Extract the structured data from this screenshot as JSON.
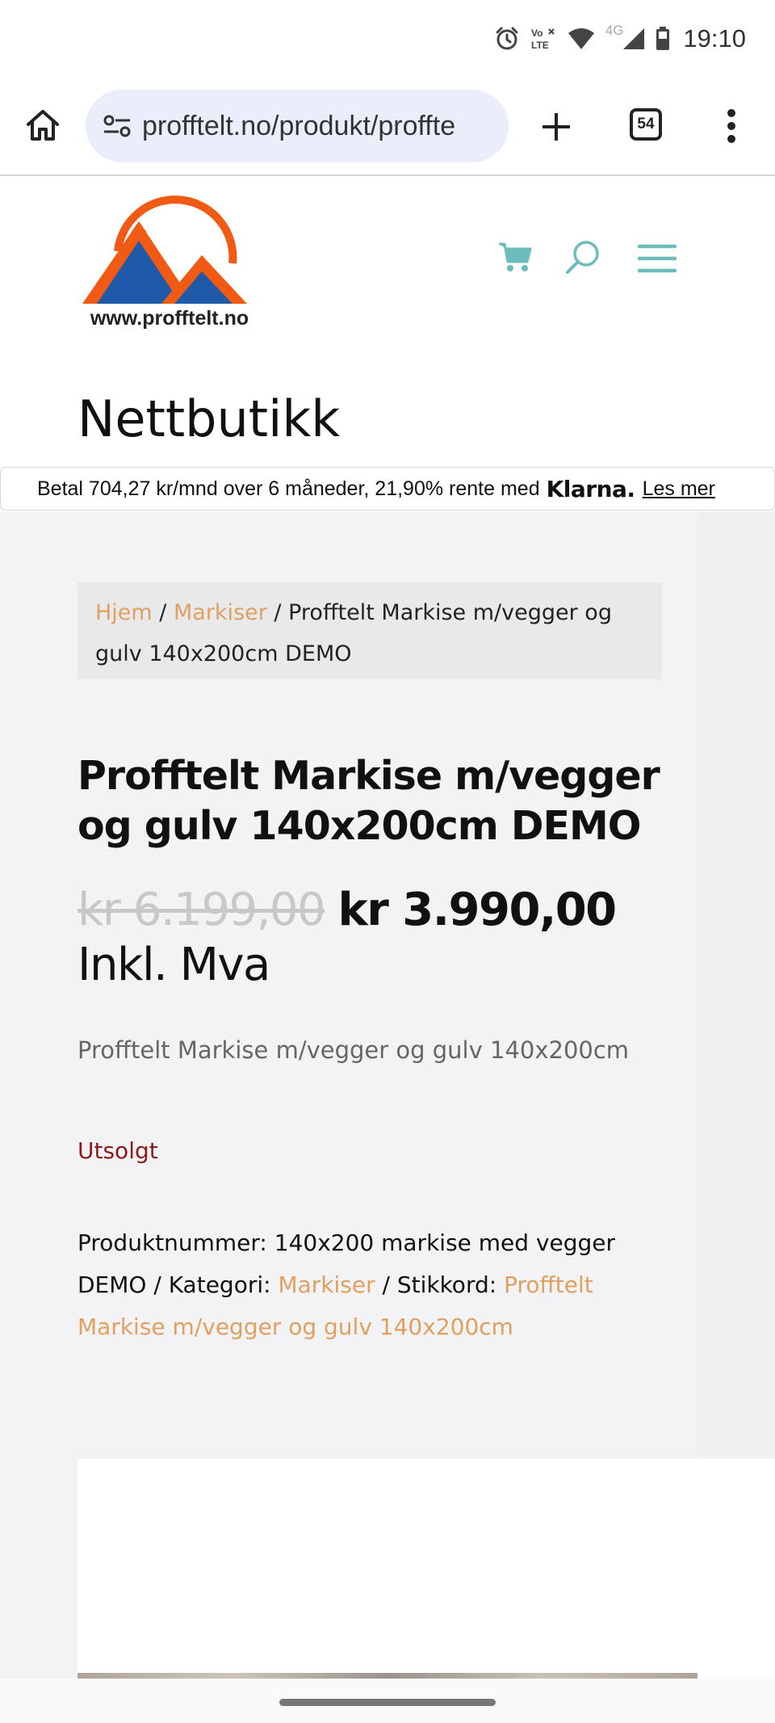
{
  "status_bar": {
    "time": "19:10",
    "network": "4G",
    "volte": "Vo LTE",
    "icons": [
      "alarm-icon",
      "volte-icon",
      "wifi-icon",
      "signal-icon",
      "battery-icon"
    ]
  },
  "browser": {
    "url": "profftelt.no/produkt/proffte",
    "tab_count": "54",
    "icons": [
      "home-icon",
      "site-settings-icon",
      "plus-icon",
      "tabs-icon",
      "more-vert-icon"
    ]
  },
  "header": {
    "logo_text": "www.profftelt.no",
    "icons": [
      "cart-icon",
      "search-icon",
      "menu-icon"
    ],
    "accent_color": "#6cbcbc"
  },
  "page": {
    "heading": "Nettbutikk"
  },
  "klarna": {
    "text": "Betal 704,27 kr/mnd over 6 måneder, 21,90% rente med",
    "logo": "Klarna.",
    "link": "Les mer"
  },
  "breadcrumb": {
    "home": "Hjem",
    "sep1": " / ",
    "category": "Markiser",
    "sep2": " / ",
    "current": "Profftelt Markise m/vegger og gulv 140x200cm DEMO"
  },
  "product": {
    "title": "Profftelt Markise m/vegger og gulv 140x200cm DEMO",
    "price_old": "kr 6.199,00",
    "price_new": "kr 3.990,00",
    "price_suffix": "Inkl. Mva",
    "short_description": "Profftelt Markise m/vegger og gulv 140x200cm",
    "stock_status": "Utsolgt",
    "meta": {
      "sku_label": "Produktnummer: ",
      "sku": "140x200 markise med vegger DEMO",
      "category_label": " / Kategori: ",
      "category": "Markiser",
      "tags_label": " / Stikkord: ",
      "tag": "Profftelt Markise m/vegger og gulv 140x200cm"
    }
  },
  "colors": {
    "link": "#e0a060",
    "stock": "#8b1a1a",
    "logo_orange": "#f05a14",
    "logo_blue": "#1f5aa8"
  }
}
